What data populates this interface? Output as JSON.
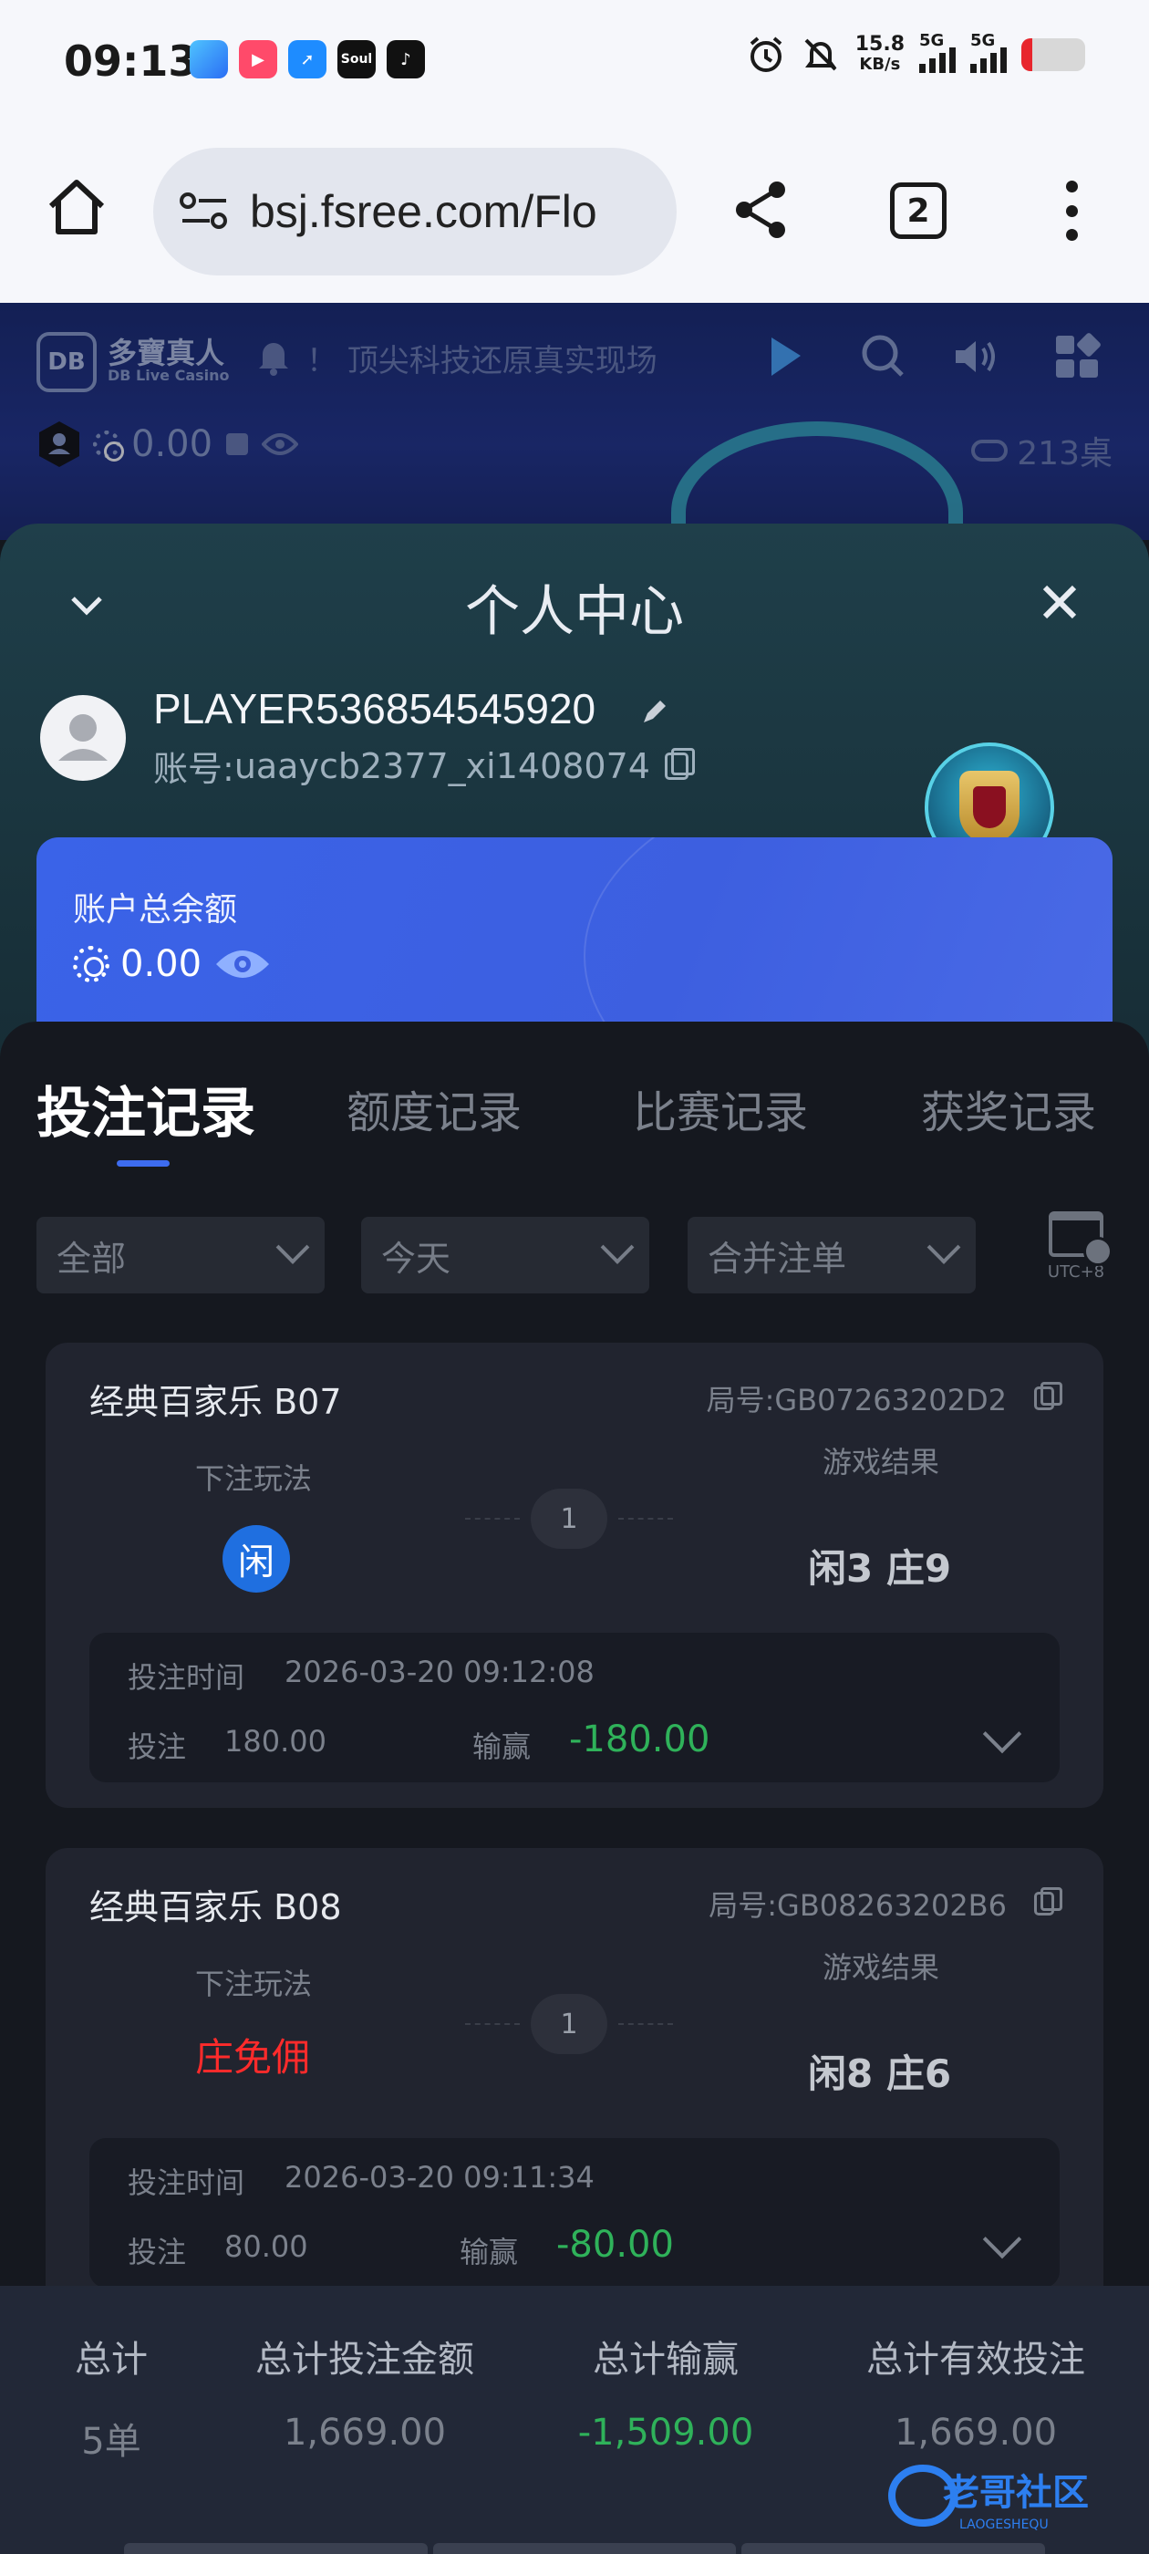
{
  "status_bar": {
    "time": "09:13",
    "net_speed": "15.8",
    "net_speed_unit": "KB/s",
    "sim1": "5G",
    "sim2": "5G",
    "soul_label": "Soul"
  },
  "browser": {
    "url": "bsj.fsree.com/Flo",
    "tab_count": "2"
  },
  "casino_header": {
    "logo_mark": "DB",
    "logo_cn": "多寶真人",
    "logo_en": "DB Live Casino",
    "marquee": "！ 顶尖科技还原真实现场",
    "balance": "0.00",
    "tables": "213桌"
  },
  "panel": {
    "title": "个人中心",
    "player_name": "PLAYER536854545920",
    "account_label": "账号:",
    "account": "uaaycb2377_xi1408074",
    "balance_label": "账户总余额",
    "balance": "0.00"
  },
  "tabs": [
    {
      "label": "投注记录",
      "active": true
    },
    {
      "label": "额度记录",
      "active": false
    },
    {
      "label": "比赛记录",
      "active": false
    },
    {
      "label": "获奖记录",
      "active": false
    }
  ],
  "filters": {
    "type": "全部",
    "date": "今天",
    "merge": "合并注单",
    "timezone": "UTC+8"
  },
  "records": [
    {
      "game": "经典百家乐 B07",
      "round": "局号:GB07263202D2",
      "bet_type_label": "下注玩法",
      "bet_type": "闲",
      "count": "1",
      "result_label": "游戏结果",
      "result": "闲3 庄9",
      "time_label": "投注时间",
      "time": "2026-03-20 09:12:08",
      "stake_label": "投注",
      "stake": "180.00",
      "winloss_label": "输赢",
      "winloss": "-180.00"
    },
    {
      "game": "经典百家乐 B08",
      "round": "局号:GB08263202B6",
      "bet_type_label": "下注玩法",
      "bet_type": "庄免佣",
      "count": "1",
      "result_label": "游戏结果",
      "result": "闲8 庄6",
      "time_label": "投注时间",
      "time": "2026-03-20 09:11:34",
      "stake_label": "投注",
      "stake": "80.00",
      "winloss_label": "输赢",
      "winloss": "-80.00"
    }
  ],
  "summary": {
    "total_label": "总计",
    "total": "5单",
    "bet_amount_label": "总计投注金额",
    "bet_amount": "1,669.00",
    "winloss_label": "总计输赢",
    "winloss": "-1,509.00",
    "valid_bet_label": "总计有效投注",
    "valid_bet": "1,669.00"
  },
  "watermark": {
    "text": "老哥社区",
    "sub": "LAOGESHEQU"
  },
  "colors": {
    "accent_blue": "#3d6cf0",
    "win_green": "#2fb25a",
    "banker_red": "#ff2b2b",
    "player_blue": "#1f6fe0"
  }
}
